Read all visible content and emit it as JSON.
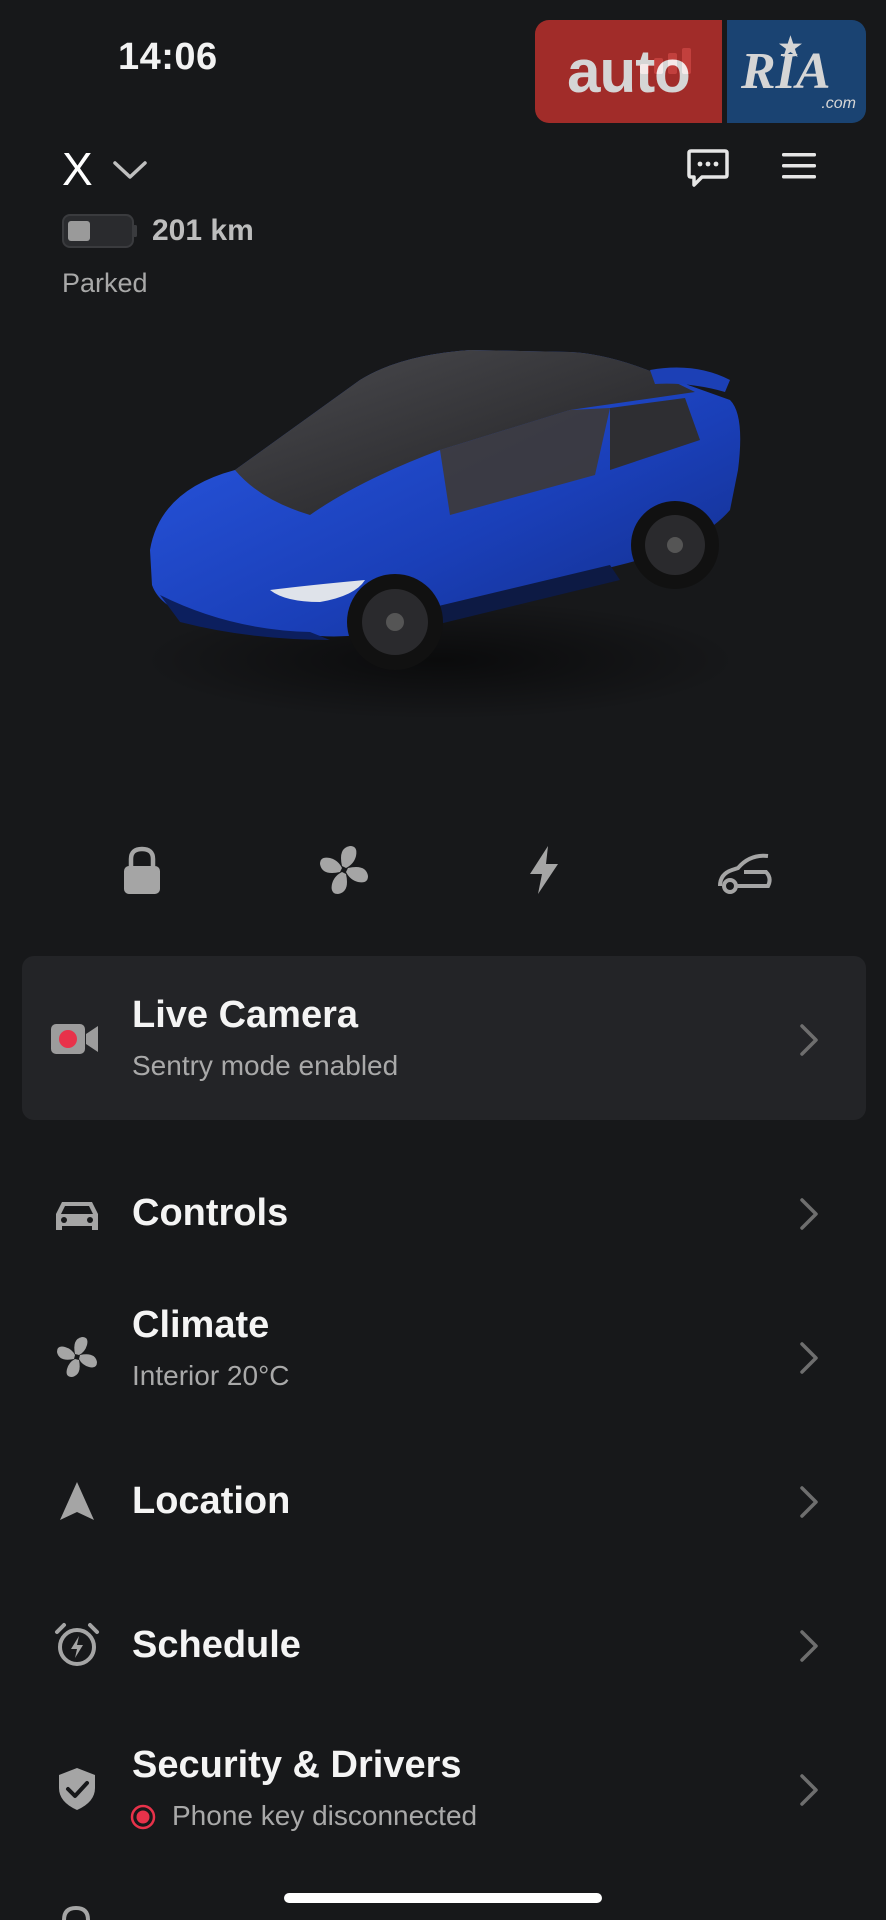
{
  "status_bar": {
    "time": "14:06"
  },
  "watermark": {
    "left": "auto",
    "right": "RIA",
    "domain": ".com"
  },
  "header": {
    "car_name": "X",
    "range": "201 km",
    "status": "Parked"
  },
  "quick_controls": [
    {
      "icon": "lock-icon"
    },
    {
      "icon": "fan-icon"
    },
    {
      "icon": "charge-icon"
    },
    {
      "icon": "frunk-icon"
    }
  ],
  "camera_card": {
    "title": "Live Camera",
    "subtitle": "Sentry mode enabled"
  },
  "menu": {
    "controls": {
      "title": "Controls"
    },
    "climate": {
      "title": "Climate",
      "subtitle": "Interior 20°C"
    },
    "location": {
      "title": "Location"
    },
    "schedule": {
      "title": "Schedule"
    },
    "security": {
      "title": "Security & Drivers",
      "subtitle": "Phone key disconnected"
    }
  },
  "colors": {
    "background": "#17181a",
    "card": "#232427",
    "accent_red": "#e8324a",
    "car_blue": "#1d46c9"
  }
}
